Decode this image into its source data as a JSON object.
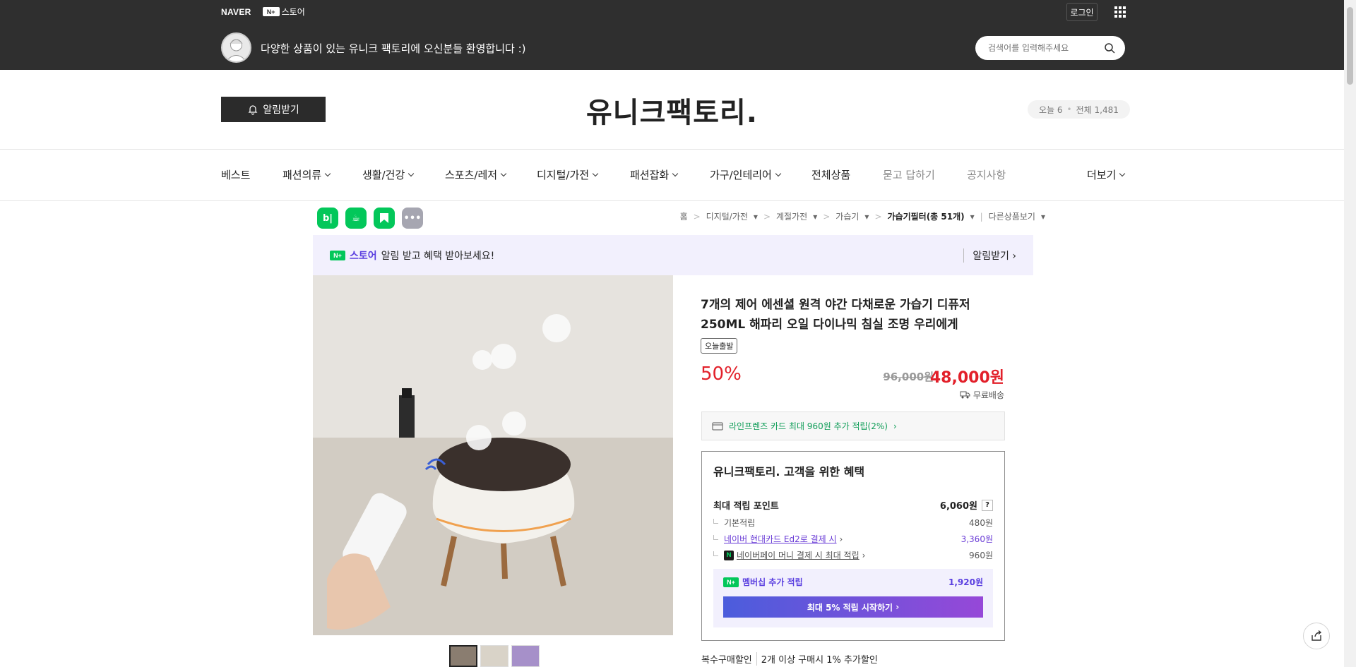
{
  "gnb": {
    "naver": "NAVER",
    "nstore_mark": "N+",
    "nstore": "스토어",
    "login": "로그인"
  },
  "store": {
    "welcome": "다양한 상품이 있는 유니크 팩토리에 오신분들 환영합니다 :)",
    "search_placeholder": "검색어를 입력해주세요",
    "notify_button": "알림받기",
    "logo": "유니크팩토리.",
    "visit_today": "오늘 6",
    "visit_total": "전체 1,481"
  },
  "menu": [
    {
      "label": "베스트"
    },
    {
      "label": "패션의류"
    },
    {
      "label": "생활/건강"
    },
    {
      "label": "스포츠/레저"
    },
    {
      "label": "디지털/가전"
    },
    {
      "label": "패션잡화"
    },
    {
      "label": "가구/인테리어"
    },
    {
      "label": "전체상품"
    },
    {
      "label": "묻고 답하기"
    },
    {
      "label": "공지사항"
    },
    {
      "label": "더보기"
    }
  ],
  "share": {
    "blog": "b|",
    "cafe": "☕",
    "bookmark": "▼",
    "more": "•••"
  },
  "breadcrumb": {
    "home": "홈",
    "c1": "디지털/가전",
    "c2": "계절가전",
    "c3": "가습기",
    "c4": "가습기필터(총 51개)",
    "other": "다른상품보기"
  },
  "alert_banner": {
    "mark": "N+",
    "store": "스토어",
    "text": "알림 받고 혜택 받아보세요!",
    "action": "알림받기"
  },
  "product": {
    "name_line1": "7개의 제어 에센셜 원격 야간 다채로운 가습기 디퓨저",
    "name_line2": "250ML 해파리 오일 다이나믹 침실 조명 우리에게",
    "badge": "오늘출발",
    "discount": "50%",
    "origin_price": "96,000원",
    "price": "48,000원",
    "shipping": "무료배송",
    "card_promo": "라인프렌즈 카드 최대 960원 추가 적립(2%)"
  },
  "benefit": {
    "title": "유니크팩토리. 고객을 위한 혜택",
    "max_label": "최대 적립 포인트",
    "max_value": "6,060원",
    "help": "?",
    "basic_label": "기본적립",
    "basic_value": "480원",
    "card_label": "네이버 현대카드 Ed2로 결제 시",
    "card_value": "3,360원",
    "npay_mark": "N",
    "npay_label": "네이버페이 머니 결제 시 최대 적립",
    "npay_value": "960원",
    "member_mark": "N+",
    "member_label": "멤버십 추가 적립",
    "member_value": "1,920원",
    "member_cta": "최대 5% 적립 시작하기"
  },
  "multi_discount": {
    "label": "복수구매할인",
    "text": "2개 이상 구매시 1% 추가할인"
  },
  "colors": {
    "topbar": "#2f2f2f",
    "sale": "#e2202a",
    "naver_green": "#03c75a",
    "membership_purple": "#5a3fe0"
  }
}
